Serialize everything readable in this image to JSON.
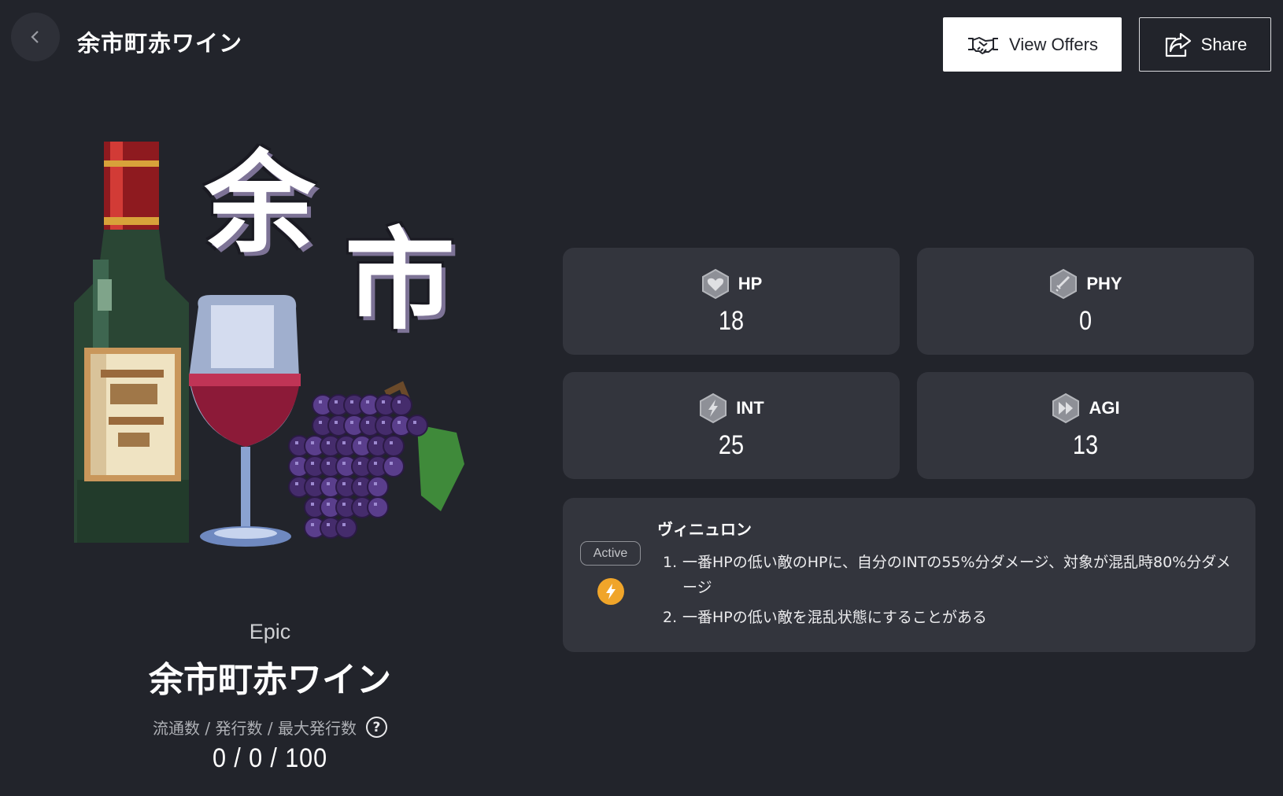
{
  "header": {
    "title": "余市町赤ワイン",
    "back_icon": "chevron-left-icon",
    "view_offers_label": "View Offers",
    "view_offers_icon": "handshake-icon",
    "share_label": "Share",
    "share_icon": "share-icon"
  },
  "artwork": {
    "title_chars": [
      "余",
      "市"
    ]
  },
  "item": {
    "rarity": "Epic",
    "name": "余市町赤ワイン",
    "supply_label": "流通数 / 発行数 / 最大発行数",
    "supply_value": "0 / 0 / 100"
  },
  "stats": [
    {
      "key": "HP",
      "value": "18",
      "icon": "heart-hex-icon"
    },
    {
      "key": "PHY",
      "value": "0",
      "icon": "sword-hex-icon"
    },
    {
      "key": "INT",
      "value": "25",
      "icon": "lightning-hex-icon"
    },
    {
      "key": "AGI",
      "value": "13",
      "icon": "fast-forward-hex-icon"
    }
  ],
  "skill": {
    "badge": "Active",
    "icon": "lightning-icon",
    "name": "ヴィニュロン",
    "effects": [
      "一番HPの低い敵のHPに、自分のINTの55%分ダメージ、対象が混乱時80%分ダメージ",
      "一番HPの低い敵を混乱状態にすることがある"
    ]
  },
  "colors": {
    "background": "#22242b",
    "card": "#33353d",
    "accent": "#f0a52a"
  }
}
